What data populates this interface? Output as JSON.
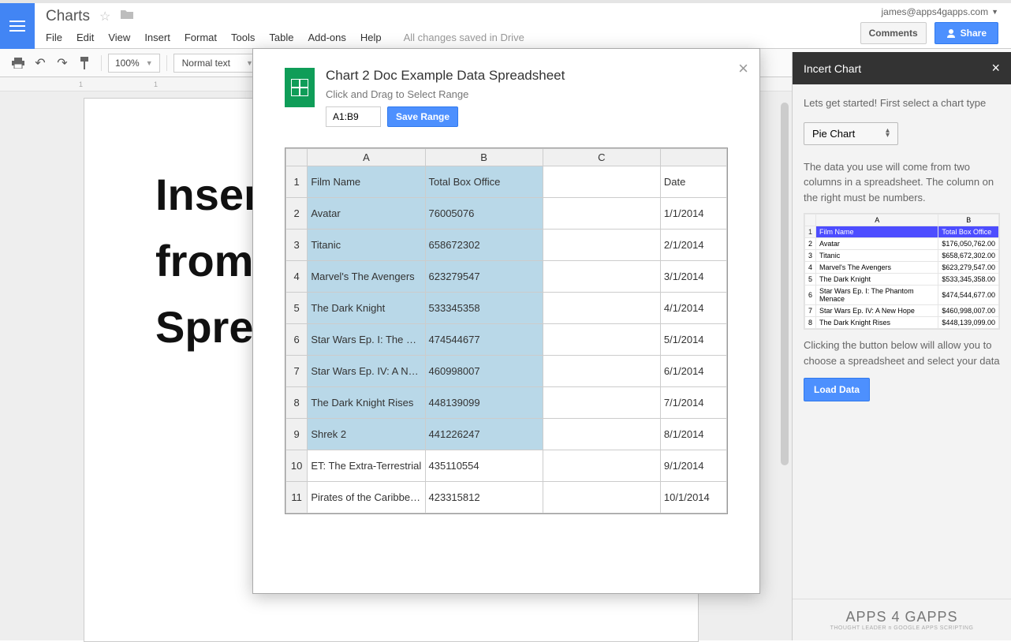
{
  "header": {
    "title": "Charts",
    "account": "james@apps4gapps.com",
    "menus": [
      "File",
      "Edit",
      "View",
      "Insert",
      "Format",
      "Tools",
      "Table",
      "Add-ons",
      "Help"
    ],
    "saved": "All changes saved in Drive",
    "comments": "Comments",
    "share": "Share"
  },
  "toolbar": {
    "zoom": "100%",
    "style": "Normal text"
  },
  "ruler": {
    "marks": [
      "1",
      "1"
    ]
  },
  "page": {
    "line1": "Inser",
    "line2": "from",
    "line3": "Spre"
  },
  "modal": {
    "title": "Chart 2 Doc Example Data Spreadsheet",
    "subtitle": "Click and Drag to Select Range",
    "range": "A1:B9",
    "save_range": "Save Range",
    "columns": [
      "A",
      "B",
      "C",
      ""
    ],
    "rows": [
      {
        "n": "1",
        "a": "Film Name",
        "b": "Total Box Office",
        "c": "",
        "d": "Date",
        "sel": true
      },
      {
        "n": "2",
        "a": "Avatar",
        "b": "76005076",
        "c": "",
        "d": "1/1/2014",
        "sel": true
      },
      {
        "n": "3",
        "a": "Titanic",
        "b": "658672302",
        "c": "",
        "d": "2/1/2014",
        "sel": true
      },
      {
        "n": "4",
        "a": "Marvel's The Avengers",
        "b": "623279547",
        "c": "",
        "d": "3/1/2014",
        "sel": true
      },
      {
        "n": "5",
        "a": "The Dark Knight",
        "b": "533345358",
        "c": "",
        "d": "4/1/2014",
        "sel": true
      },
      {
        "n": "6",
        "a": "Star Wars Ep. I: The P…",
        "b": "474544677",
        "c": "",
        "d": "5/1/2014",
        "sel": true
      },
      {
        "n": "7",
        "a": "Star Wars Ep. IV: A Ne…",
        "b": "460998007",
        "c": "",
        "d": "6/1/2014",
        "sel": true
      },
      {
        "n": "8",
        "a": "The Dark Knight Rises",
        "b": "448139099",
        "c": "",
        "d": "7/1/2014",
        "sel": true
      },
      {
        "n": "9",
        "a": "Shrek 2",
        "b": "441226247",
        "c": "",
        "d": "8/1/2014",
        "sel": true
      },
      {
        "n": "10",
        "a": "ET: The Extra-Terrestrial",
        "b": "435110554",
        "c": "",
        "d": "9/1/2014",
        "sel": false
      },
      {
        "n": "11",
        "a": "Pirates of the Caribbea…",
        "b": "423315812",
        "c": "",
        "d": "10/1/2014",
        "sel": false
      }
    ]
  },
  "sidebar": {
    "title": "Incert Chart",
    "intro": "Lets get started! First select a chart type",
    "chart_type": "Pie Chart",
    "explain": "The data you use will come from two columns in a spreadsheet. The column on the right must be numbers.",
    "preview_cols": [
      "A",
      "B"
    ],
    "preview_header": [
      "Film Name",
      "Total Box Office"
    ],
    "preview_rows": [
      {
        "n": "2",
        "a": "Avatar",
        "b": "$176,050,762.00"
      },
      {
        "n": "3",
        "a": "Titanic",
        "b": "$658,672,302.00"
      },
      {
        "n": "4",
        "a": "Marvel's The Avengers",
        "b": "$623,279,547.00"
      },
      {
        "n": "5",
        "a": "The Dark Knight",
        "b": "$533,345,358.00"
      },
      {
        "n": "6",
        "a": "Star Wars Ep. I: The Phantom Menace",
        "b": "$474,544,677.00"
      },
      {
        "n": "7",
        "a": "Star Wars Ep. IV: A New Hope",
        "b": "$460,998,007.00"
      },
      {
        "n": "8",
        "a": "The Dark Knight Rises",
        "b": "$448,139,099.00"
      }
    ],
    "click_text": "Clicking the button below will allow you to choose a spreadsheet and select your data",
    "load": "Load Data",
    "footer_logo": "APPS 4 GAPPS",
    "footer_sub": "THOUGHT LEADER n GOOGLE APPS SCRIPTING"
  }
}
